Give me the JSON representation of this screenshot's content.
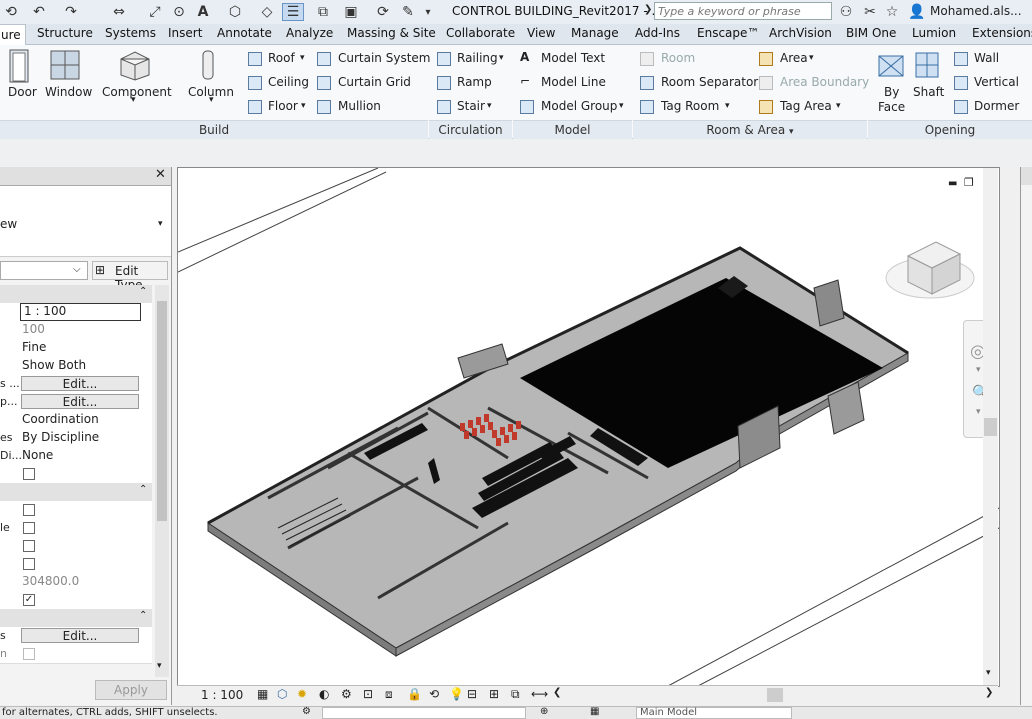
{
  "title_bar": {
    "document_title": "CONTROL BUILDING_Revit2017 - ...",
    "search_placeholder": "Type a keyword or phrase",
    "user_name": "Mohamed.als..."
  },
  "tabs": [
    {
      "label": "ure"
    },
    {
      "label": "Structure"
    },
    {
      "label": "Systems"
    },
    {
      "label": "Insert"
    },
    {
      "label": "Annotate"
    },
    {
      "label": "Analyze"
    },
    {
      "label": "Massing & Site"
    },
    {
      "label": "Collaborate"
    },
    {
      "label": "View"
    },
    {
      "label": "Manage"
    },
    {
      "label": "Add-Ins"
    },
    {
      "label": "Enscape™"
    },
    {
      "label": "ArchVision"
    },
    {
      "label": "BIM One"
    },
    {
      "label": "Lumion"
    },
    {
      "label": "Extensions"
    }
  ],
  "ribbon": {
    "build": {
      "large": [
        "Door",
        "Window",
        "Component",
        "Column"
      ],
      "small": [
        "Roof",
        "Ceiling",
        "Floor",
        "Curtain System",
        "Curtain Grid",
        "Mullion"
      ],
      "panel_label": "Build"
    },
    "circulation": {
      "items": [
        "Railing",
        "Ramp",
        "Stair"
      ],
      "panel_label": "Circulation"
    },
    "model": {
      "items": [
        "Model Text",
        "Model Line",
        "Model Group"
      ],
      "panel_label": "Model"
    },
    "room_area": {
      "items": [
        "Room",
        "Room Separator",
        "Tag Room",
        "Area",
        "Area Boundary",
        "Tag Area"
      ],
      "panel_label": "Room & Area"
    },
    "opening": {
      "items": [
        "By",
        "Face",
        "Shaft",
        "Wall",
        "Vertical",
        "Dormer"
      ],
      "panel_label": "Opening"
    }
  },
  "properties": {
    "type_label": "ew",
    "edit_type": "Edit Type",
    "rows": [
      {
        "label": "",
        "value": "1 : 100"
      },
      {
        "label": "",
        "value": "100"
      },
      {
        "label": "",
        "value": "Fine"
      },
      {
        "label": "",
        "value": "Show Both"
      },
      {
        "label": "s ...",
        "value": "Edit..."
      },
      {
        "label": "p...",
        "value": "Edit..."
      },
      {
        "label": "",
        "value": "Coordination"
      },
      {
        "label": "es",
        "value": "By Discipline"
      },
      {
        "label": "Di...",
        "value": "None"
      },
      {
        "label": "le",
        "value": ""
      },
      {
        "label": "",
        "value": "304800.0"
      },
      {
        "label": "s",
        "value": "Edit..."
      },
      {
        "label": "n",
        "value": ""
      }
    ],
    "apply_label": "Apply"
  },
  "view_bar": {
    "scale": "1 : 100"
  },
  "status_bar": {
    "hint": "for alternates, CTRL adds, SHIFT unselects.",
    "workset": "Main Model"
  },
  "colors": {
    "accent": "#2b5797",
    "model": "#3a3a3a"
  }
}
